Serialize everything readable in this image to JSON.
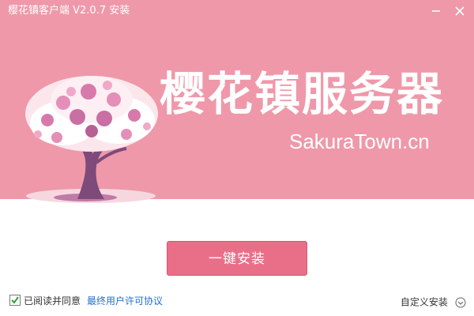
{
  "window": {
    "title": "樱花镇客户端 V2.0.7 安装"
  },
  "banner": {
    "title": "樱花镇服务器",
    "url": "SakuraTown.cn"
  },
  "actions": {
    "install_button": "一键安装",
    "custom_install": "自定义安装"
  },
  "agreement": {
    "checked": true,
    "label": "已阅读并同意",
    "link": "最终用户许可协议"
  },
  "colors": {
    "banner": "#ef98a9",
    "button": "#e96f88",
    "link": "#1f6fcf"
  },
  "icons": {
    "minimize": "minimize-icon",
    "close": "close-icon",
    "checkbox": "checkmark-icon",
    "chevron": "chevron-down-circle-icon"
  }
}
